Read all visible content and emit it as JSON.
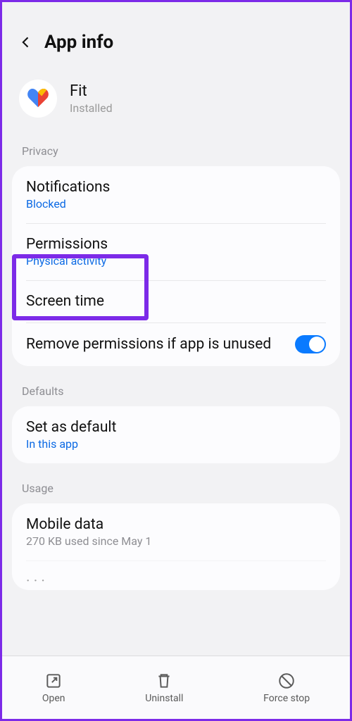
{
  "header": {
    "title": "App info"
  },
  "app": {
    "name": "Fit",
    "status": "Installed"
  },
  "sections": {
    "privacy": {
      "label": "Privacy",
      "notifications": {
        "title": "Notifications",
        "sub": "Blocked"
      },
      "permissions": {
        "title": "Permissions",
        "sub": "Physical activity"
      },
      "screen_time": {
        "title": "Screen time"
      },
      "remove_perms": {
        "title": "Remove permissions if app is unused",
        "toggle": true
      }
    },
    "defaults": {
      "label": "Defaults",
      "set_default": {
        "title": "Set as default",
        "sub": "In this app"
      }
    },
    "usage": {
      "label": "Usage",
      "mobile_data": {
        "title": "Mobile data",
        "sub": "270 KB used since May 1"
      }
    }
  },
  "bottom": {
    "open": "Open",
    "uninstall": "Uninstall",
    "force_stop": "Force stop"
  }
}
